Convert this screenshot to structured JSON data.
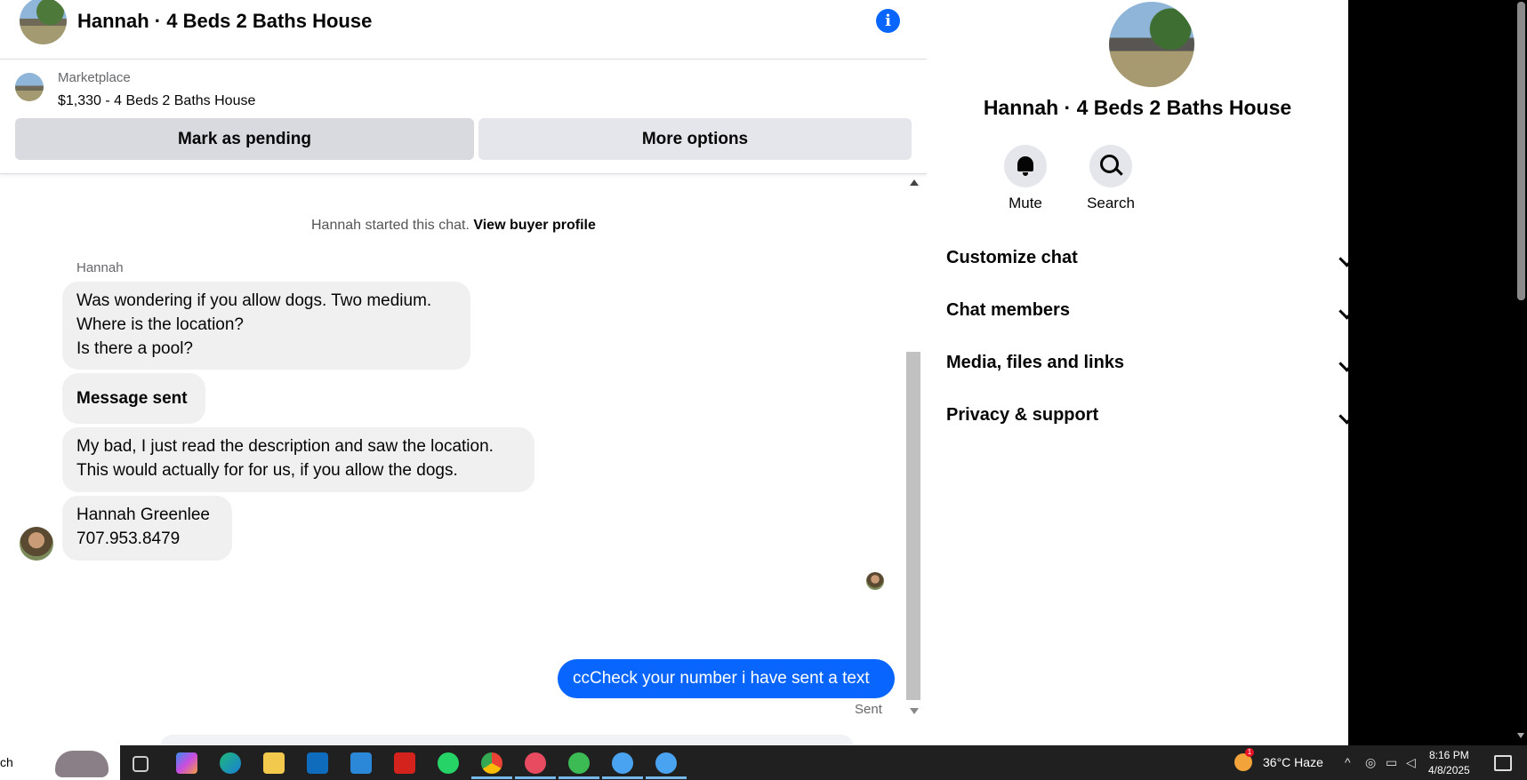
{
  "chat_header": {
    "title": "Hannah · 4 Beds 2 Baths House",
    "info_icon": "info-icon"
  },
  "listing": {
    "source": "Marketplace",
    "title": "$1,330 - 4 Beds 2 Baths House",
    "pending_label": "Mark as pending",
    "options_label": "More options"
  },
  "conversation": {
    "started_text": "Hannah started this chat.",
    "buyer_profile_link": "View buyer profile",
    "sender_name": "Hannah",
    "messages": [
      {
        "lines": [
          "Was wondering if you allow dogs. Two medium.",
          "Where is the location?",
          "Is there a pool?"
        ]
      },
      {
        "lines": [
          "Message sent"
        ]
      },
      {
        "lines": [
          "My bad, I just read the description and saw the location.",
          "This would actually for for us, if you allow the dogs."
        ]
      },
      {
        "lines": [
          "Hannah Greenlee",
          "707.953.8479"
        ]
      }
    ],
    "outgoing": "ccCheck your number i have sent a text",
    "status": "Sent"
  },
  "side_panel": {
    "title": "Hannah · 4 Beds 2 Baths House",
    "actions": [
      {
        "label": "Mute",
        "icon": "bell-icon"
      },
      {
        "label": "Search",
        "icon": "search-icon"
      }
    ],
    "sections": [
      "Customize chat",
      "Chat members",
      "Media, files and links",
      "Privacy & support"
    ]
  },
  "taskbar": {
    "search_text": "ch",
    "weather_badge": "1",
    "weather": "36°C  Haze",
    "time": "8:16 PM",
    "date": "4/8/2025",
    "apps": [
      "task-view-icon",
      "copilot-icon",
      "edge-icon",
      "file-explorer-icon",
      "outlook-icon",
      "store-icon",
      "acrobat-icon",
      "whatsapp-icon",
      "chrome-icon",
      "app-icon",
      "app-icon",
      "app-icon",
      "app-icon"
    ]
  },
  "colors": {
    "accent": "#0866ff",
    "bubble_in": "#f0f0f0",
    "taskbar": "#202020"
  }
}
